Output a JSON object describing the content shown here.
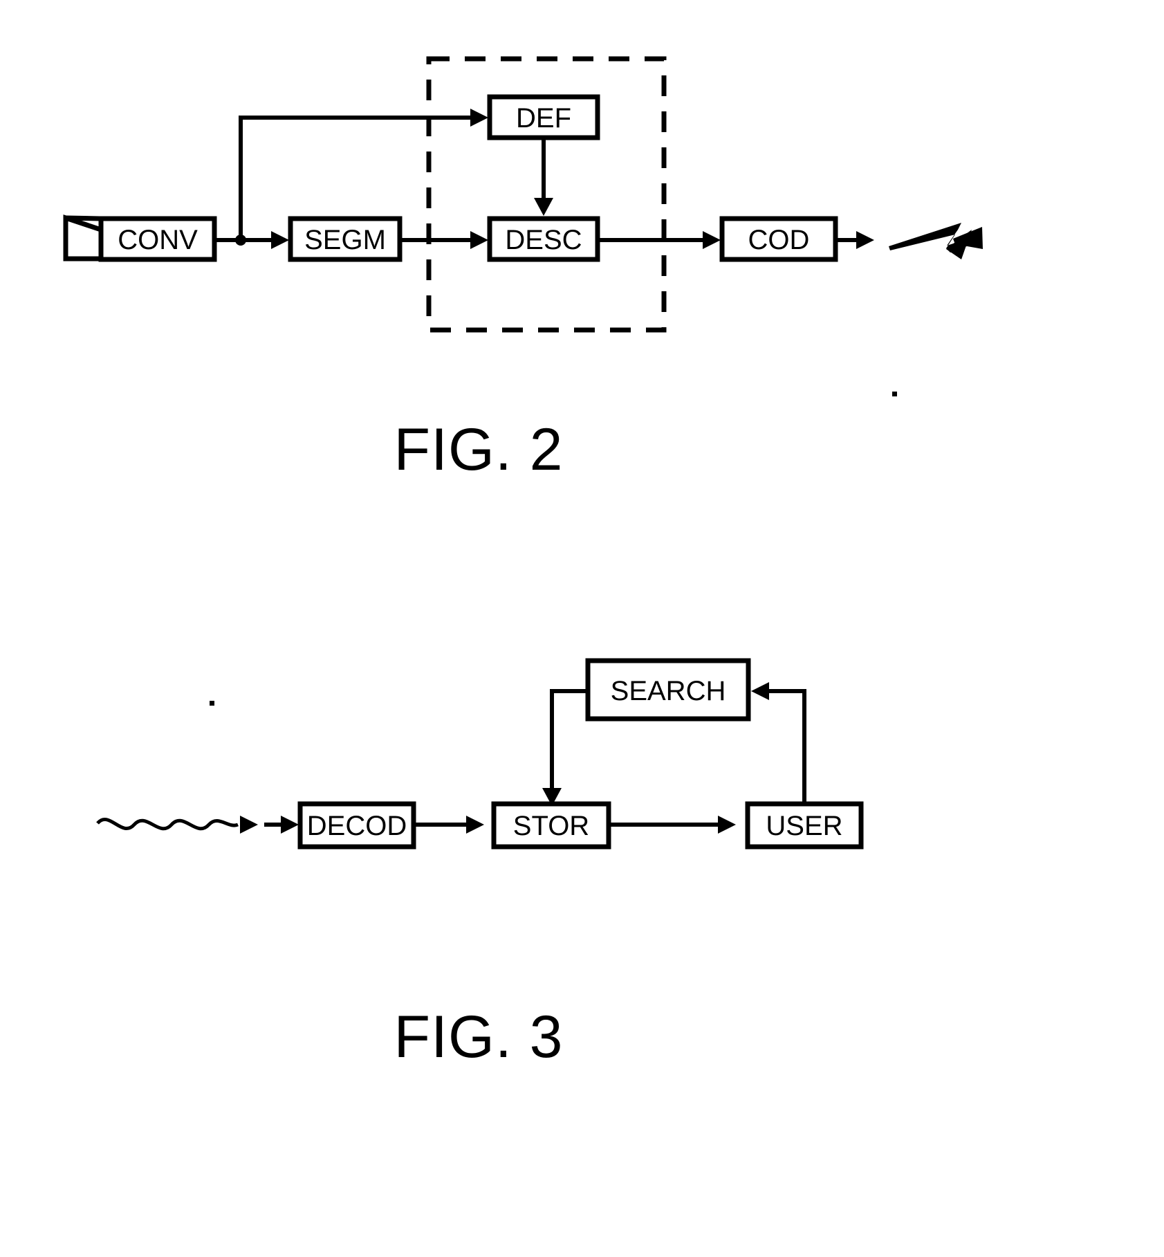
{
  "figures": [
    {
      "id": "fig2",
      "caption": "FIG. 2",
      "boxes": [
        {
          "id": "conv",
          "label": "CONV"
        },
        {
          "id": "segm",
          "label": "SEGM"
        },
        {
          "id": "def",
          "label": "DEF"
        },
        {
          "id": "desc",
          "label": "DESC"
        },
        {
          "id": "cod",
          "label": "COD"
        }
      ],
      "icons": [
        {
          "id": "camera",
          "name": "camera-lens-icon"
        },
        {
          "id": "transmit",
          "name": "lightning-bolt-arrow-icon"
        },
        {
          "id": "junction",
          "name": "signal-junction-dot"
        }
      ],
      "group": {
        "id": "dashed-group",
        "name": "dashed-boundary"
      },
      "connections": [
        {
          "from": "camera",
          "to": "conv"
        },
        {
          "from": "conv",
          "to": "junction"
        },
        {
          "from": "junction",
          "to": "segm"
        },
        {
          "from": "junction",
          "to": "def"
        },
        {
          "from": "segm",
          "to": "desc"
        },
        {
          "from": "def",
          "to": "desc"
        },
        {
          "from": "desc",
          "to": "cod"
        },
        {
          "from": "cod",
          "to": "transmit"
        }
      ]
    },
    {
      "id": "fig3",
      "caption": "FIG. 3",
      "boxes": [
        {
          "id": "decod",
          "label": "DECOD"
        },
        {
          "id": "stor",
          "label": "STOR"
        },
        {
          "id": "user",
          "label": "USER"
        },
        {
          "id": "search",
          "label": "SEARCH"
        }
      ],
      "icons": [
        {
          "id": "receive",
          "name": "wavy-signal-icon"
        }
      ],
      "connections": [
        {
          "from": "receive",
          "to": "decod"
        },
        {
          "from": "decod",
          "to": "stor"
        },
        {
          "from": "stor",
          "to": "user"
        },
        {
          "from": "user",
          "to": "search"
        },
        {
          "from": "search",
          "to": "stor"
        }
      ]
    }
  ],
  "colors": {
    "stroke": "#000000",
    "fill": "#ffffff",
    "background": "#ffffff"
  }
}
